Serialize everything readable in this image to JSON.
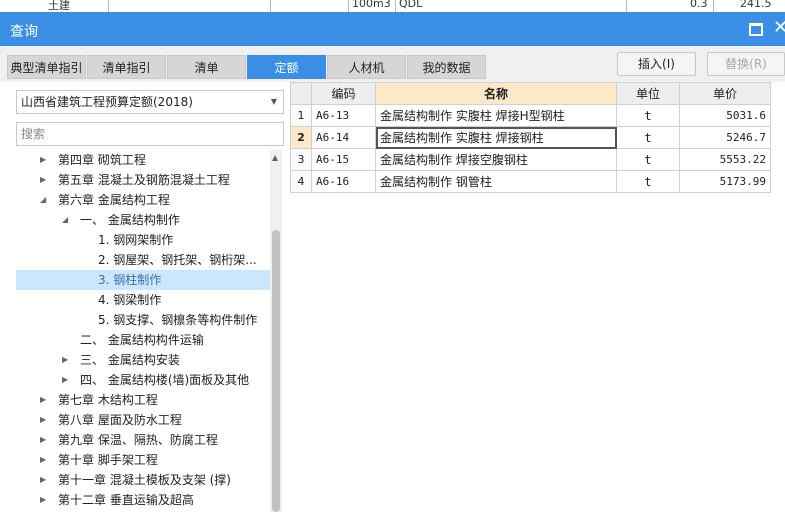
{
  "background_row": {
    "col1": "土建",
    "col2": "100m3",
    "col3": "QDL",
    "col4": "0.3",
    "col5": "241.5"
  },
  "window": {
    "title": "查询",
    "maximize_icon": "maximize-icon",
    "close_glyph": "✕"
  },
  "tabs": [
    {
      "label": "典型清单指引",
      "active": false
    },
    {
      "label": "清单指引",
      "active": false
    },
    {
      "label": "清单",
      "active": false
    },
    {
      "label": "定额",
      "active": true
    },
    {
      "label": "人材机",
      "active": false
    },
    {
      "label": "我的数据",
      "active": false
    }
  ],
  "buttons": {
    "insert": "插入(I)",
    "replace": "替换(R)"
  },
  "left_panel": {
    "quota_library": "山西省建筑工程预算定额(2018)",
    "search_placeholder": "搜索"
  },
  "tree": [
    {
      "label": "第四章 砌筑工程",
      "toggle": "right",
      "selected": false
    },
    {
      "label": "第五章 混凝土及钢筋混凝土工程",
      "toggle": "right",
      "selected": false
    },
    {
      "label": "第六章 金属结构工程",
      "toggle": "down",
      "selected": false
    },
    {
      "label": "一、 金属结构制作",
      "toggle": "down",
      "selected": false
    },
    {
      "label": "1. 钢网架制作",
      "toggle": "none",
      "selected": false
    },
    {
      "label": "2. 钢屋架、钢托架、钢桁架...",
      "toggle": "none",
      "selected": false
    },
    {
      "label": "3. 钢柱制作",
      "toggle": "none",
      "selected": true
    },
    {
      "label": "4. 钢梁制作",
      "toggle": "none",
      "selected": false
    },
    {
      "label": "5. 钢支撑、钢檩条等构件制作",
      "toggle": "none",
      "selected": false
    },
    {
      "label": "二、 金属结构构件运输",
      "toggle": "none",
      "selected": false
    },
    {
      "label": "三、 金属结构安装",
      "toggle": "right",
      "selected": false
    },
    {
      "label": "四、 金属结构楼(墙)面板及其他",
      "toggle": "right",
      "selected": false
    },
    {
      "label": "第七章 木结构工程",
      "toggle": "right",
      "selected": false
    },
    {
      "label": "第八章 屋面及防水工程",
      "toggle": "right",
      "selected": false
    },
    {
      "label": "第九章 保温、隔热、防腐工程",
      "toggle": "right",
      "selected": false
    },
    {
      "label": "第十章 脚手架工程",
      "toggle": "right",
      "selected": false
    },
    {
      "label": "第十一章 混凝土模板及支架 (撑)",
      "toggle": "right",
      "selected": false
    },
    {
      "label": "第十二章 垂直运输及超高",
      "toggle": "right",
      "selected": false
    }
  ],
  "table": {
    "headers": {
      "code": "编码",
      "name": "名称",
      "unit": "单位",
      "price": "单价"
    },
    "rows": [
      {
        "idx": "1",
        "code": "A6-13",
        "name": "金属结构制作 实腹柱 焊接H型钢柱",
        "unit": "t",
        "price": "5031.6"
      },
      {
        "idx": "2",
        "code": "A6-14",
        "name": "金属结构制作 实腹柱 焊接钢柱",
        "unit": "t",
        "price": "5246.7"
      },
      {
        "idx": "3",
        "code": "A6-15",
        "name": "金属结构制作 焊接空腹钢柱",
        "unit": "t",
        "price": "5553.22"
      },
      {
        "idx": "4",
        "code": "A6-16",
        "name": "金属结构制作 钢管柱",
        "unit": "t",
        "price": "5173.99"
      }
    ],
    "selected_row": 2
  },
  "colors": {
    "accent": "#3a8ee6",
    "selected_tree_bg": "#cce6ff",
    "header_highlight": "#fde9c8"
  }
}
